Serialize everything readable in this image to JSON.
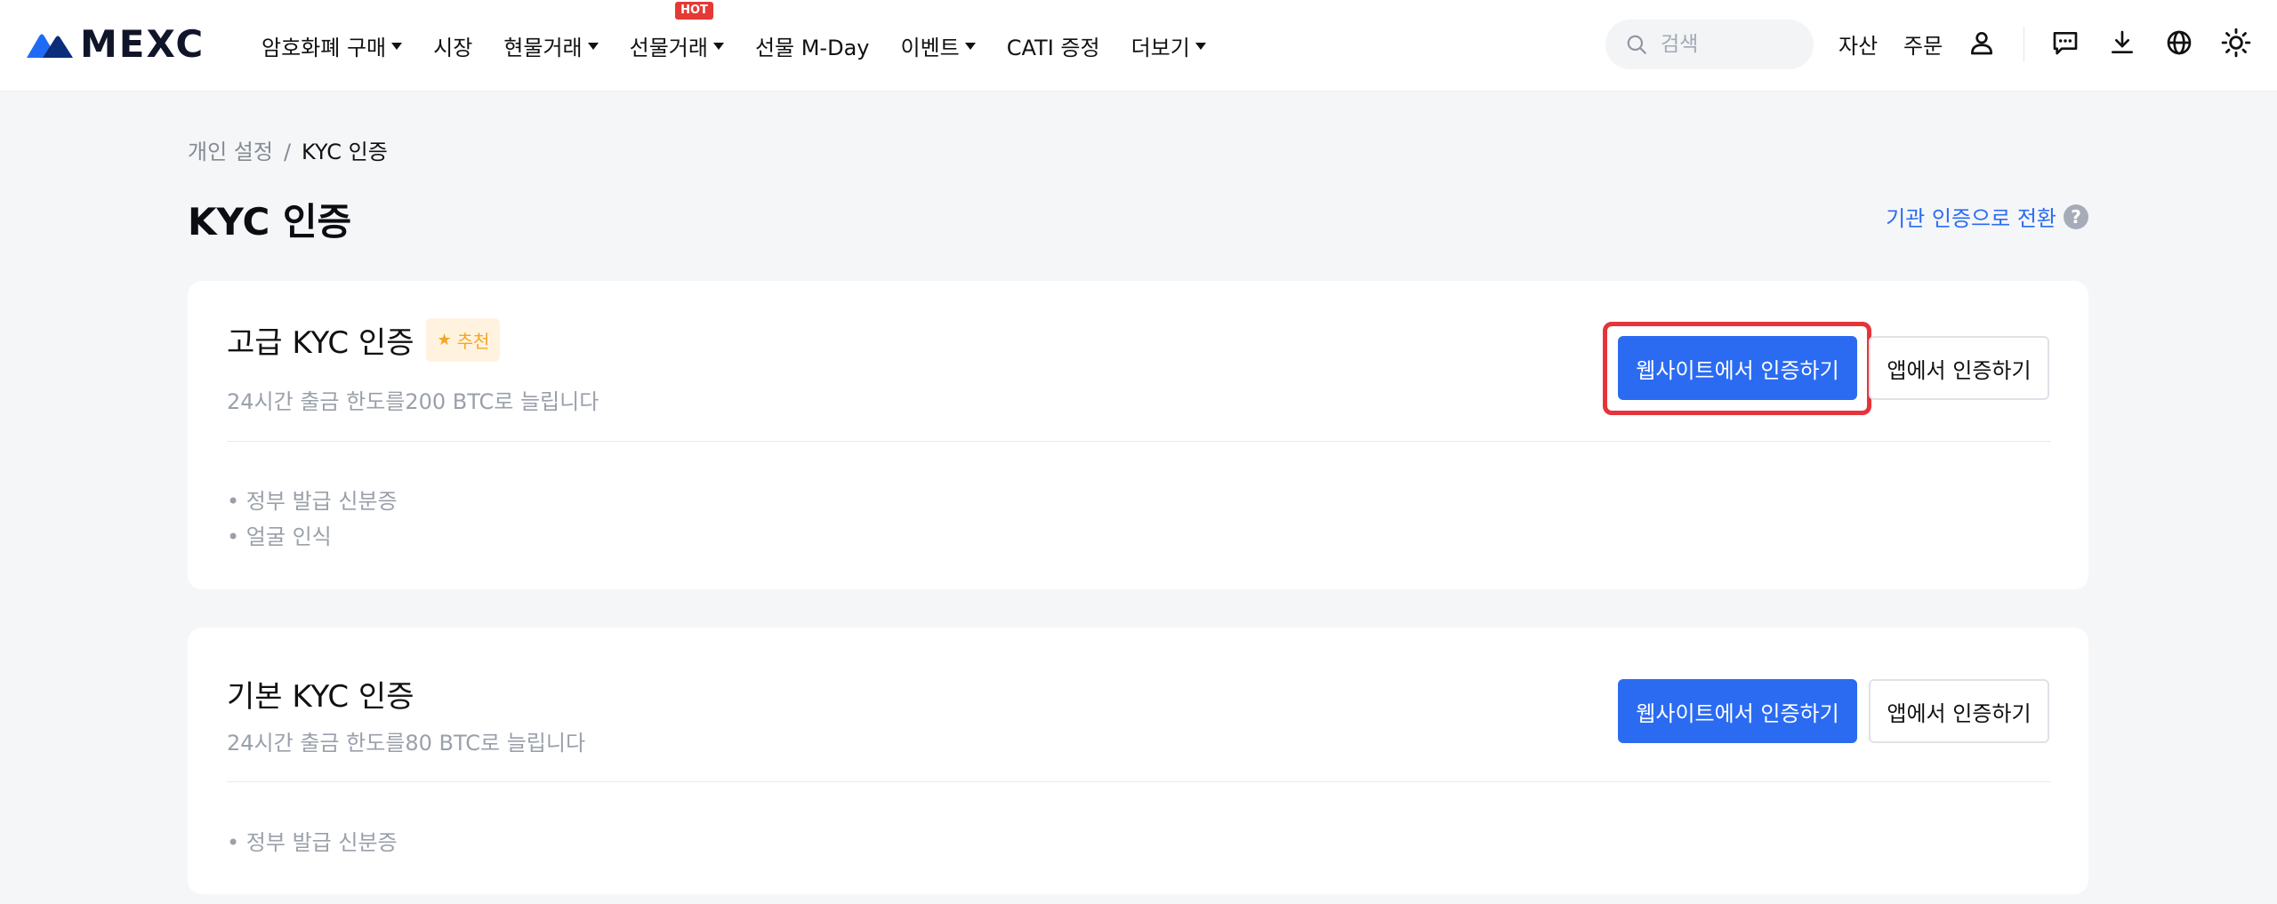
{
  "header": {
    "logo_text": "MEXC",
    "nav": [
      {
        "label": "암호화폐 구매",
        "dropdown": true
      },
      {
        "label": "시장",
        "dropdown": false
      },
      {
        "label": "현물거래",
        "dropdown": true
      },
      {
        "label": "선물거래",
        "dropdown": true,
        "badge": "HOT"
      },
      {
        "label": "선물 M-Day",
        "dropdown": false
      },
      {
        "label": "이벤트",
        "dropdown": true
      },
      {
        "label": "CATI 증정",
        "dropdown": false
      },
      {
        "label": "더보기",
        "dropdown": true
      }
    ],
    "search_placeholder": "검색",
    "assets_label": "자산",
    "orders_label": "주문",
    "icons": [
      "user-icon",
      "chat-icon",
      "download-icon",
      "globe-icon",
      "sun-icon"
    ]
  },
  "breadcrumb": {
    "parent": "개인 설정",
    "separator": "/",
    "current": "KYC 인증"
  },
  "page": {
    "title": "KYC 인증",
    "switch_link": "기관 인증으로 전환",
    "help_glyph": "?"
  },
  "cards": [
    {
      "title": "고급 KYC 인증",
      "badge": "추천",
      "subtitle": "24시간 출금 한도를200 BTC로 늘립니다",
      "requirements": [
        "정부 발급 신분증",
        "얼굴 인식"
      ],
      "primary_button": "웹사이트에서 인증하기",
      "secondary_button": "앱에서 인증하기"
    },
    {
      "title": "기본 KYC 인증",
      "subtitle": "24시간 출금 한도를80 BTC로 늘립니다",
      "requirements": [
        "정부 발급 신분증"
      ],
      "primary_button": "웹사이트에서 인증하기",
      "secondary_button": "앱에서 인증하기"
    }
  ],
  "colors": {
    "accent": "#2a6bf2",
    "highlight": "#e5343b",
    "badge_bg": "#fff3e0",
    "badge_text": "#f5a623",
    "hot": "#e53935"
  }
}
